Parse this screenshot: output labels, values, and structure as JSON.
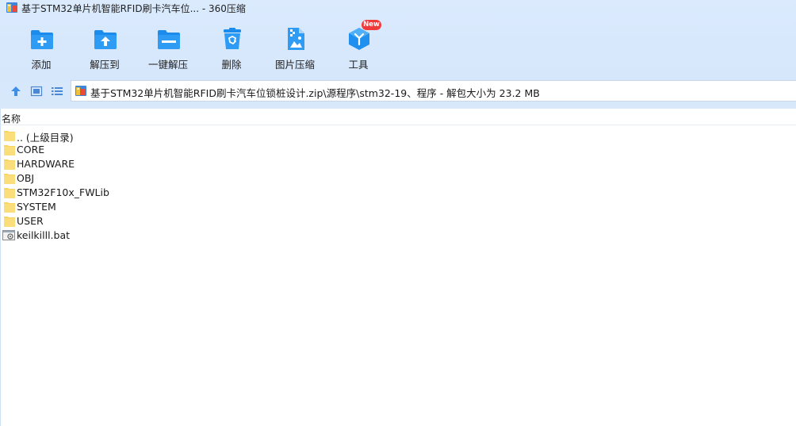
{
  "window": {
    "title": "基于STM32单片机智能RFID刷卡汽车位... - 360压缩"
  },
  "toolbar": {
    "buttons": [
      {
        "id": "add",
        "label": "添加",
        "icon": "add-folder-icon"
      },
      {
        "id": "extract",
        "label": "解压到",
        "icon": "extract-folder-icon"
      },
      {
        "id": "one_click",
        "label": "一键解压",
        "icon": "one-click-extract-icon"
      },
      {
        "id": "delete",
        "label": "删除",
        "icon": "recycle-bin-icon"
      },
      {
        "id": "image_compress",
        "label": "图片压缩",
        "icon": "image-compress-icon"
      },
      {
        "id": "tools",
        "label": "工具",
        "icon": "tools-hexagon-icon",
        "badge": "New"
      }
    ]
  },
  "navbar": {
    "icons": [
      "up-arrow-icon",
      "thumbnail-view-icon",
      "list-view-icon"
    ],
    "address": "基于STM32单片机智能RFID刷卡汽车位锁桩设计.zip\\源程序\\stm32-19、程序 - 解包大小为 23.2 MB"
  },
  "file_list": {
    "column_name": "名称",
    "items": [
      {
        "name": ".. (上级目录)",
        "type": "folder"
      },
      {
        "name": "CORE",
        "type": "folder"
      },
      {
        "name": "HARDWARE",
        "type": "folder"
      },
      {
        "name": "OBJ",
        "type": "folder"
      },
      {
        "name": "STM32F10x_FWLib",
        "type": "folder"
      },
      {
        "name": "SYSTEM",
        "type": "folder"
      },
      {
        "name": "USER",
        "type": "folder"
      },
      {
        "name": "keilkilll.bat",
        "type": "bat"
      }
    ]
  },
  "colors": {
    "accent": "#1f8ff0",
    "folder": "#f9d55f",
    "badge": "#ef3b3b",
    "toolbar_bg": "#d8e8fc"
  }
}
